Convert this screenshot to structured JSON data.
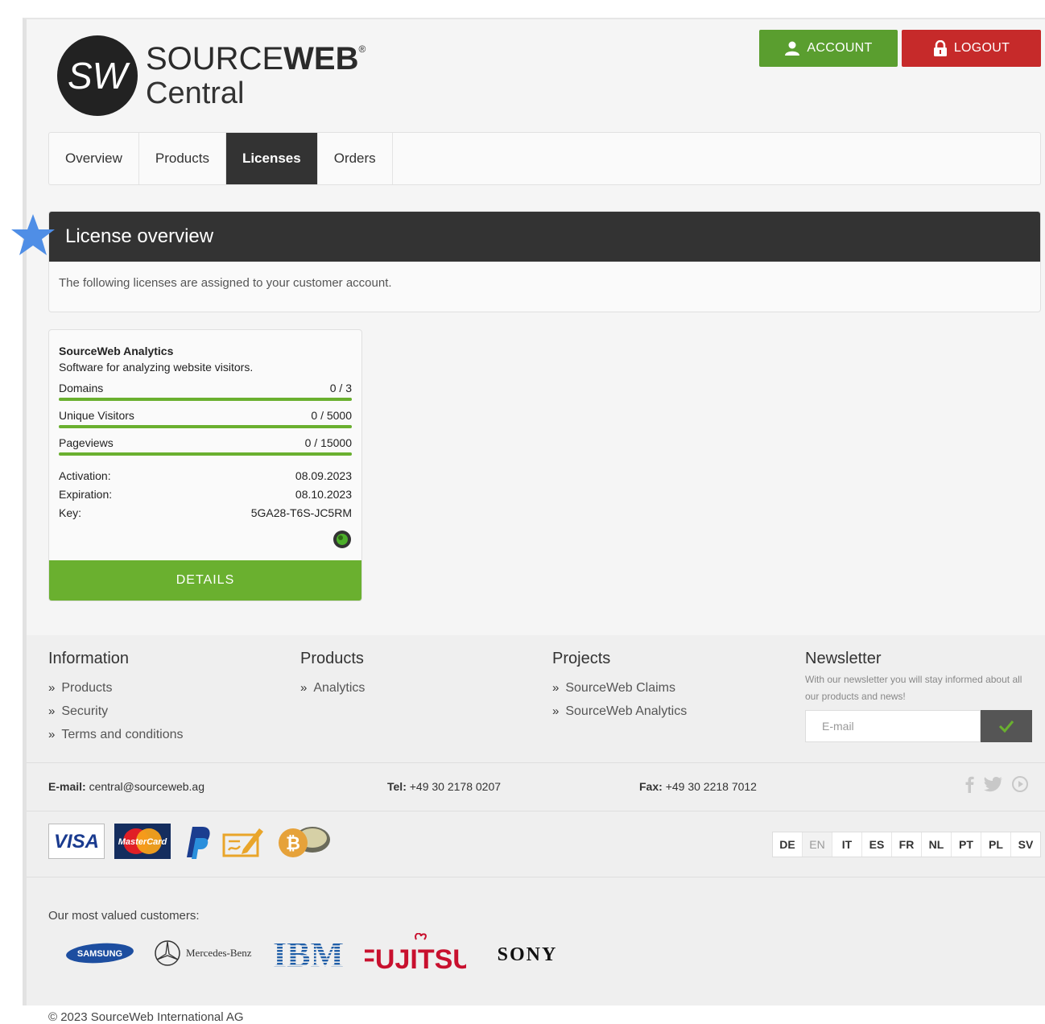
{
  "header": {
    "logo_initials": "SW",
    "logo_line1_light": "SOURCE",
    "logo_line1_bold": "WEB",
    "logo_reg": "®",
    "logo_line2": "Central",
    "account_label": "ACCOUNT",
    "logout_label": "LOGOUT"
  },
  "nav": {
    "tabs": [
      {
        "label": "Overview",
        "active": false
      },
      {
        "label": "Products",
        "active": false
      },
      {
        "label": "Licenses",
        "active": true
      },
      {
        "label": "Orders",
        "active": false
      }
    ]
  },
  "section": {
    "title": "License overview",
    "description": "The following licenses are assigned to your customer account."
  },
  "license": {
    "name": "SourceWeb Analytics",
    "description": "Software for analyzing website visitors.",
    "metrics": [
      {
        "label": "Domains",
        "value": "0 / 3",
        "fill": 1.0
      },
      {
        "label": "Unique Visitors",
        "value": "0 / 5000",
        "fill": 1.0
      },
      {
        "label": "Pageviews",
        "value": "0 / 15000",
        "fill": 1.0
      }
    ],
    "activation_label": "Activation:",
    "activation_value": "08.09.2023",
    "expiration_label": "Expiration:",
    "expiration_value": "08.10.2023",
    "key_label": "Key:",
    "key_value": "5GA28-T6S-JC5RM",
    "details_label": "DETAILS"
  },
  "footer": {
    "information": {
      "title": "Information",
      "links": [
        "Products",
        "Security",
        "Terms and conditions"
      ]
    },
    "products": {
      "title": "Products",
      "links": [
        "Analytics"
      ]
    },
    "projects": {
      "title": "Projects",
      "links": [
        "SourceWeb Claims",
        "SourceWeb Analytics"
      ]
    },
    "newsletter": {
      "title": "Newsletter",
      "description": "With our newsletter you will stay informed about all our products and news!",
      "placeholder": "E-mail"
    },
    "contact": {
      "email_label": "E-mail:",
      "email_value": "central@sourceweb.ag",
      "tel_label": "Tel:",
      "tel_value": "+49 30 2178 0207",
      "fax_label": "Fax:",
      "fax_value": "+49 30 2218 7012"
    },
    "payment_icons": [
      "visa-icon",
      "mastercard-icon",
      "paypal-icon",
      "invoice-icon",
      "bitcoin-icon"
    ],
    "payment_visa": "VISA",
    "payment_mastercard": "MasterCard",
    "languages": [
      {
        "code": "DE",
        "current": false
      },
      {
        "code": "EN",
        "current": true
      },
      {
        "code": "IT",
        "current": false
      },
      {
        "code": "ES",
        "current": false
      },
      {
        "code": "FR",
        "current": false
      },
      {
        "code": "NL",
        "current": false
      },
      {
        "code": "PT",
        "current": false
      },
      {
        "code": "PL",
        "current": false
      },
      {
        "code": "SV",
        "current": false
      }
    ],
    "customers_label": "Our most valued customers:",
    "customers": [
      "SAMSUNG",
      "Mercedes-Benz",
      "IBM",
      "FUJITSU",
      "SONY"
    ],
    "copyright": "© 2023 SourceWeb International AG"
  },
  "colors": {
    "green": "#6ab02f",
    "account_green": "#5a9e2f",
    "logout_red": "#c62a2a",
    "dark": "#333333"
  }
}
